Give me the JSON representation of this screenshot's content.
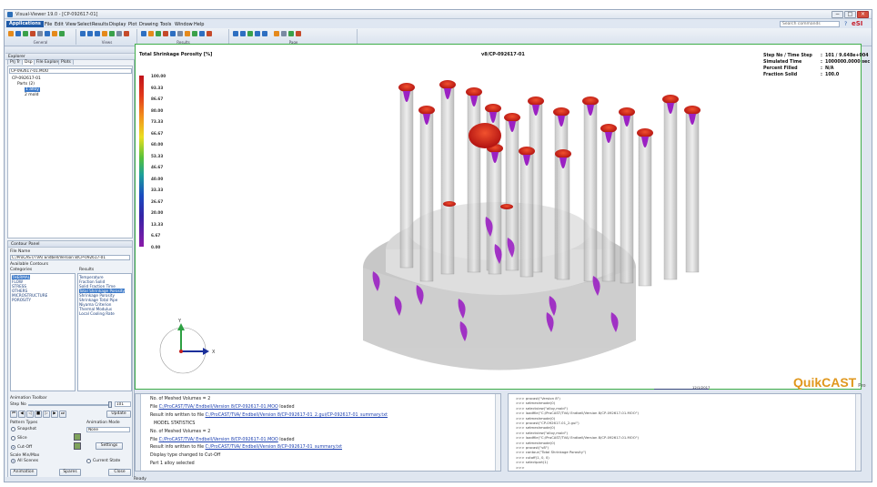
{
  "window": {
    "title": "Visual-Viewer 19.0 - [CP-092617-01]",
    "controls": {
      "minimize": "−",
      "maximize": "□",
      "close": "×"
    }
  },
  "menu": {
    "items": [
      "Applications",
      "File",
      "Edit",
      "View",
      "Select",
      "Results",
      "Display",
      "Plot",
      "Drawing",
      "Tools",
      "Window",
      "Help"
    ],
    "search_placeholder": "Search commands",
    "help_glyph": "?",
    "brand": "eSI"
  },
  "ribbon": {
    "groups": [
      "General",
      "Views",
      "Results",
      "Page"
    ],
    "colors": {
      "accent": "#e0971d",
      "icon_blue": "#2e6fc1",
      "icon_orange": "#e58a1c",
      "icon_green": "#3aa14a"
    }
  },
  "explorer": {
    "header": "Explorer",
    "tabs": [
      "Prj Tr",
      "Dsp",
      "File Explorer",
      "Plots"
    ],
    "tree": {
      "root": "CP-092617-01.MOO",
      "case": "CP-092617-01",
      "part_group": "Parts (2)",
      "parts": [
        "1 alloy",
        "2 mold"
      ]
    }
  },
  "contour_panel": {
    "header": "Contour Panel",
    "file_name_label": "File Name",
    "file_name_value": "C:/ProCAST/TVA/ Endbell/Version 8/CP-092617-01",
    "available_contours_label": "Available Contours",
    "categories_label": "Categories",
    "results_label": "Results",
    "categories": [
      "THERMAL",
      "FLOW",
      "STRESS",
      "OTHERS",
      "MICROSTRUCTURE",
      "POROSITY"
    ],
    "results": [
      "Temperature",
      "Fraction Solid",
      "Solid Fraction Time",
      "Total Shrinkage Porosity",
      "Shrinkage Porosity",
      "Shrinkage Total Pipe",
      "Niyama Criterion",
      "Thermal Modulus",
      "Local Cooling Rate"
    ],
    "selected_category": "THERMAL",
    "selected_result": "Total Shrinkage Porosity",
    "animation_toolbar_label": "Animation Toolbar",
    "step_no_label": "Step No",
    "step_no_value": "101",
    "update_button": "Update",
    "pattern_types_label": "Pattern Types",
    "animation_mode_label": "Animation Mode",
    "pattern_options": [
      "Snapshot",
      "Slice",
      "Cut-Off"
    ],
    "pattern_selected": "Cut-Off",
    "animation_mode_value": "None",
    "settings_button": "Settings",
    "scale_min_max_label": "Scale Min/Max",
    "scale_options": [
      "All Scenes",
      "Current State"
    ],
    "scale_selected": "All Scenes",
    "buttons": {
      "animation": "Animation",
      "spare": "Spares",
      "close": "Close"
    }
  },
  "viewport": {
    "result_title": "Total Shrinkage Porosity [%]",
    "case_title": "v8/CP-092617-01",
    "stats": [
      {
        "key": "Step No / Time Step",
        "value": "101 / 9.648e+004"
      },
      {
        "key": "Simulated Time",
        "value": "1000000.0000 sec"
      },
      {
        "key": "Percent Filled",
        "value": "N/A"
      },
      {
        "key": "Fraction Solid",
        "value": "100.0"
      }
    ],
    "legend_values": [
      "100.00",
      "93.33",
      "86.67",
      "80.00",
      "73.33",
      "66.67",
      "60.00",
      "53.33",
      "46.67",
      "40.00",
      "33.33",
      "26.67",
      "20.00",
      "13.33",
      "6.67",
      "0.00"
    ],
    "brand": "QuikCAST",
    "brand_sub": "Pro",
    "date": "12/1/2017",
    "triad_labels": {
      "x": "X",
      "y": "Y",
      "z": "Z"
    },
    "colors": {
      "frame": "#3fae49",
      "brand": "#e0971d",
      "porosity": "#9b21c3",
      "hot_top": "#d02518"
    }
  },
  "messages": {
    "lines": [
      {
        "text": "No. of Meshed Volumes",
        "value": "= 2"
      },
      {
        "prefix": "File ",
        "link": "C:/ProCAST/TVA/ Endbell/Version 8/CP-092617-01.MOO",
        "suffix": " loaded"
      },
      {
        "prefix": "Result info written to file ",
        "link": "C:/ProCAST/TVA/ Endbell/Version 8/CP-092617-01_2.gui/CP-092617-01_summary.txt"
      },
      {
        "text": "MODEL STATISTICS"
      },
      {
        "text": "No. of Meshed Volumes",
        "value": "= 2"
      },
      {
        "prefix": "File ",
        "link": "C:/ProCAST/TVA/ Endbell/Version 8/CP-092617-01.MOO",
        "suffix": " loaded"
      },
      {
        "prefix": "Result info written to file ",
        "link": "C:/ProCAST/TVA/ Endbell/Version 8/CP-092617-01_summary.txt"
      },
      {
        "text": "Display type changed to Cut-Off"
      },
      {
        "text": "Part 1 alloy selected"
      }
    ]
  },
  "console": {
    "lines": [
      ">>> procast(\"Version 8\")",
      ">>> setmeshmode(0)",
      ">>> selectview(\"alloy,mold\")",
      ">>> loadfile(\"C:/ProCAST/TVA/ Endbell/Version 8/CP-092617-01.MOO\")",
      ">>> setmeshmode(0)",
      ">>> procast(\"CP-092617-01_2.gui\")",
      ">>> setmeshmode(0)",
      ">>> selectview(\"alloy,mold\")",
      ">>> loadfile(\"C:/ProCAST/TVA/ Endbell/Version 8/CP-092617-01.MOO\")",
      ">>> setmeshmode(0)",
      ">>> procast(\"v8\")",
      ">>> contour(\"Total Shrinkage Porosity\")",
      ">>> cutoff(1, 0, 0)",
      ">>> selectpart(1)",
      ">>>"
    ]
  },
  "status": {
    "text": "Ready"
  }
}
